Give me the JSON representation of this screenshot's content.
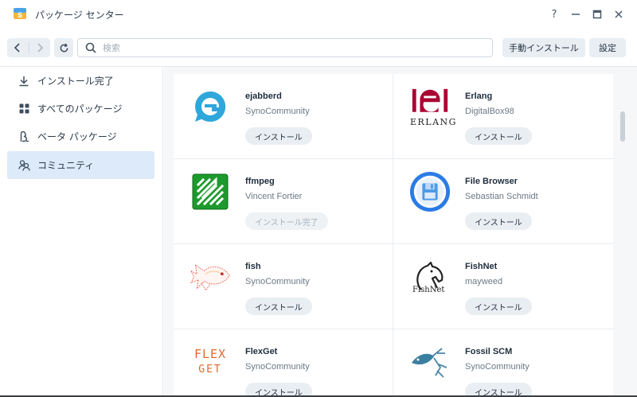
{
  "window": {
    "title": "パッケージ センター",
    "help": "?",
    "minimize": "—",
    "maximize": "▭",
    "close": "✕"
  },
  "toolbar": {
    "search_placeholder": "検索",
    "manual_install": "手動インストール",
    "settings": "設定"
  },
  "sidebar": {
    "items": [
      {
        "label": "インストール完了",
        "icon": "download-icon"
      },
      {
        "label": "すべてのパッケージ",
        "icon": "grid-icon"
      },
      {
        "label": "ベータ パッケージ",
        "icon": "beta-icon"
      },
      {
        "label": "コミュニティ",
        "icon": "community-icon",
        "active": true
      }
    ]
  },
  "packages": [
    {
      "name": "ejabberd",
      "author": "SynoCommunity",
      "action": "インストール"
    },
    {
      "name": "Erlang",
      "author": "DigitalBox98",
      "action": "インストール",
      "logo_text": "ERLANG"
    },
    {
      "name": "ffmpeg",
      "author": "Vincent Fortier",
      "action": "インストール完了"
    },
    {
      "name": "File Browser",
      "author": "Sebastian Schmidt",
      "action": "インストール"
    },
    {
      "name": "fish",
      "author": "SynoCommunity",
      "action": "インストール"
    },
    {
      "name": "FishNet",
      "author": "mayweed",
      "action": "インストール",
      "logo_text": "FishNet"
    },
    {
      "name": "FlexGet",
      "author": "SynoCommunity",
      "action": "インストール",
      "logo_text_1": "FLEX",
      "logo_text_2": "GET"
    },
    {
      "name": "Fossil SCM",
      "author": "SynoCommunity",
      "action": "インストール"
    }
  ],
  "colors": {
    "accent": "#0086e5",
    "active_bg": "#dceaf9",
    "erlang_red": "#a90533",
    "ffmpeg_green": "#1d9a2d",
    "flexget_orange": "#e2672b"
  }
}
